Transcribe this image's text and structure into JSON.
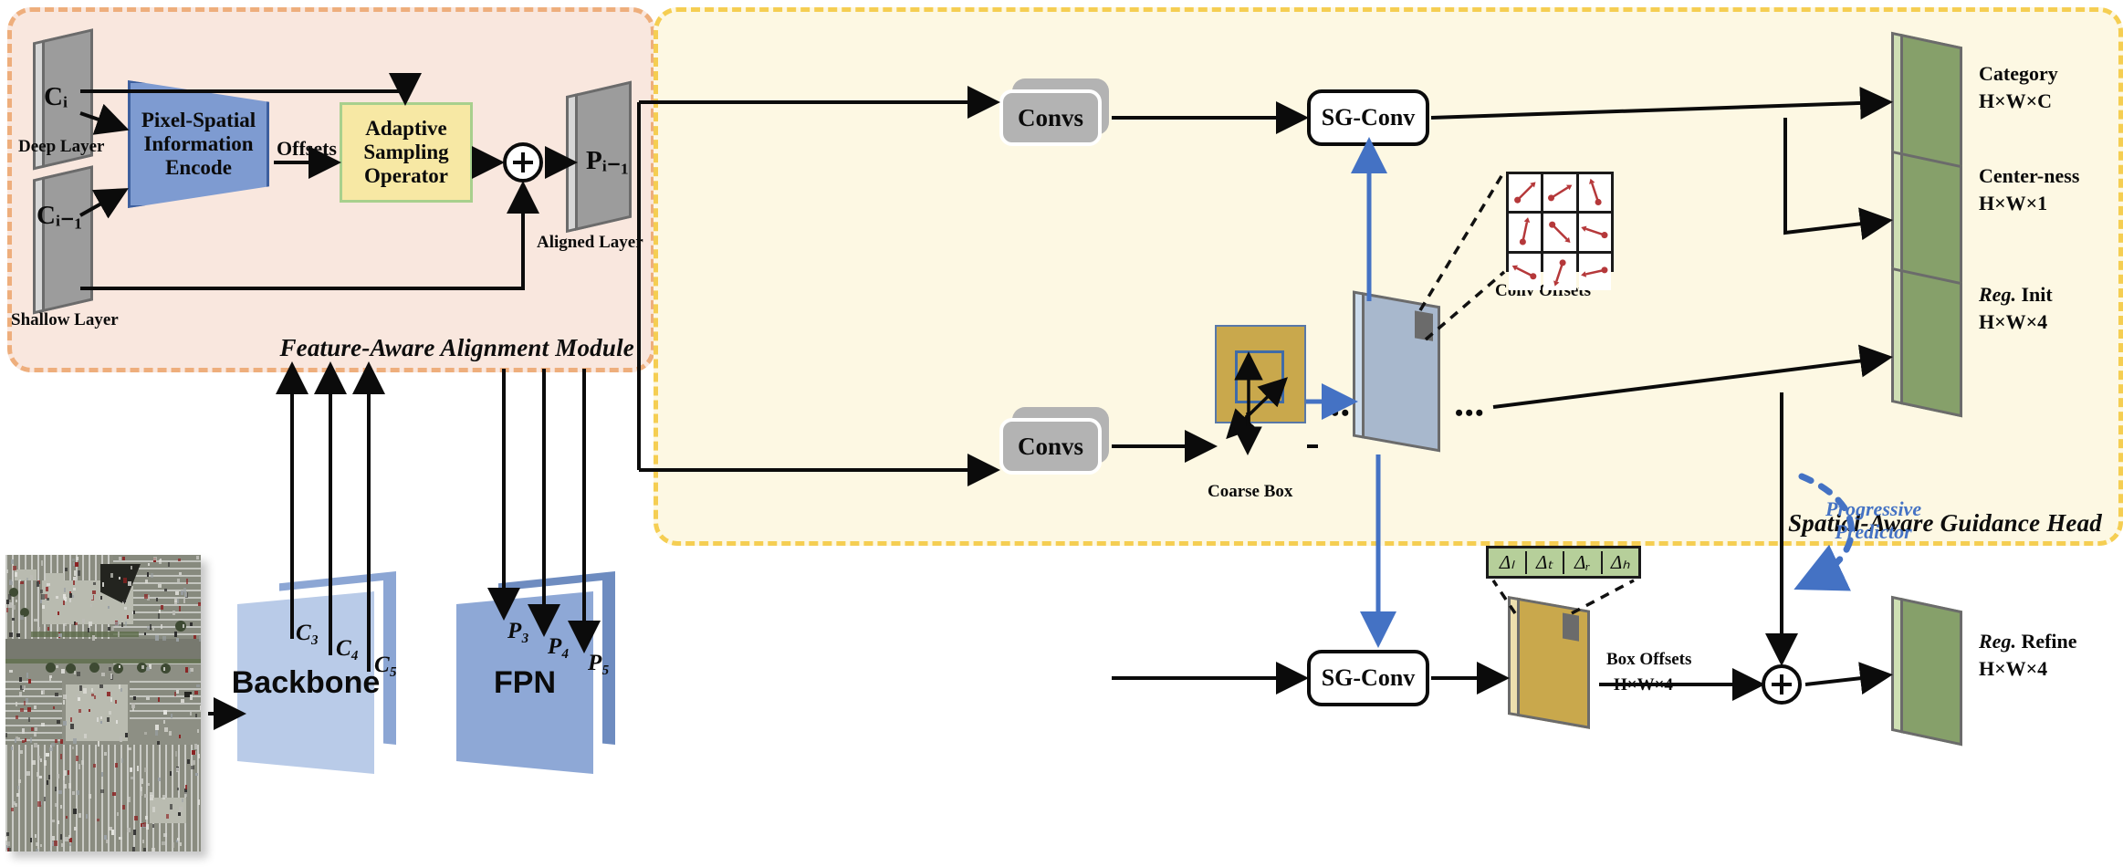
{
  "figure": {
    "type": "architecture-diagram",
    "modules": [
      {
        "id": "faam",
        "title": "Feature-Aware Alignment Module",
        "fill": "#f9e7de",
        "border": "#eeae7c"
      },
      {
        "id": "sagh",
        "title": "Spatial-Aware Guidance Head",
        "fill": "#fdf8e3",
        "border": "#f5ce52"
      }
    ]
  },
  "alignment_module": {
    "deep_layer": {
      "symbol": "Cᵢ",
      "caption": "Deep Layer"
    },
    "shallow_layer": {
      "symbol": "Cᵢ₋₁",
      "caption": "Shallow Layer"
    },
    "encoder": {
      "line1": "Pixel-Spatial",
      "line2": "Information",
      "line3": "Encode",
      "fill": "#7e9bd1",
      "border": "#3d5f9e"
    },
    "offsets_label": "Offsets",
    "sampler": {
      "line1": "Adaptive",
      "line2": "Sampling",
      "line3": "Operator",
      "fill": "#f7e8a4",
      "border": "#a8d08d"
    },
    "sum_symbol": "+",
    "output": {
      "symbol": "Pᵢ₋₁",
      "caption": "Aligned Layer"
    }
  },
  "backbone_stage": {
    "image_caption": "",
    "backbone_label": "Backbone",
    "fpn_label": "FPN",
    "backbone_outputs": [
      "C₃",
      "C₄",
      "C₅"
    ],
    "fpn_outputs": [
      "P₃",
      "P₄",
      "P₅"
    ]
  },
  "guidance_head": {
    "convs_top_label": "Convs",
    "convs_bottom_label": "Convs",
    "sgconv_top_label": "SG-Conv",
    "sgconv_bottom_label": "SG-Conv",
    "coarse_box_label": "Coarse Box",
    "conv_offsets_label": "Conv Offsets",
    "box_offsets_label": "Box Offsets",
    "box_offsets_dims": "H×W×4",
    "delta_cells": [
      "Δₗ",
      "Δₜ",
      "Δᵣ",
      "Δₕ"
    ],
    "progressive_predictor": {
      "line1": "Progressive",
      "line2": "Predictor",
      "color": "#4472c4"
    },
    "ellipsis": "•••",
    "sum_symbol": "+",
    "outputs": [
      {
        "name": "Category",
        "dims": "H×W×C",
        "italic_prefix": ""
      },
      {
        "name": "Center-ness",
        "dims": "H×W×1",
        "italic_prefix": ""
      },
      {
        "name": "Init",
        "dims": "H×W×4",
        "italic_prefix": "Reg."
      },
      {
        "name": "Refine",
        "dims": "H×W×4",
        "italic_prefix": "Reg."
      }
    ]
  },
  "colors": {
    "feature_plate_gray": "#9c9c9c",
    "output_plate_green": "#86a06a",
    "offset_plate_blue": "#a8b8cd",
    "box_plate_gold": "#c9a84c",
    "backbone_blue": "#b9cbe8",
    "fpn_blue": "#8ea8d6",
    "arrow_black": "#0b0b0b",
    "arrow_blue": "#4472c4",
    "offset_arrow_red": "#b5383a"
  },
  "conv_offsets_grid": {
    "rows": 3,
    "cols": 3,
    "vectors": [
      {
        "dx": 0.7,
        "dy": -0.7
      },
      {
        "dx": 0.8,
        "dy": -0.5
      },
      {
        "dx": -0.3,
        "dy": -0.9
      },
      {
        "dx": 0.2,
        "dy": -0.95
      },
      {
        "dx": 0.7,
        "dy": 0.7
      },
      {
        "dx": -0.9,
        "dy": -0.3
      },
      {
        "dx": -0.8,
        "dy": -0.4
      },
      {
        "dx": -0.3,
        "dy": 0.9
      },
      {
        "dx": -0.9,
        "dy": 0.2
      }
    ]
  }
}
